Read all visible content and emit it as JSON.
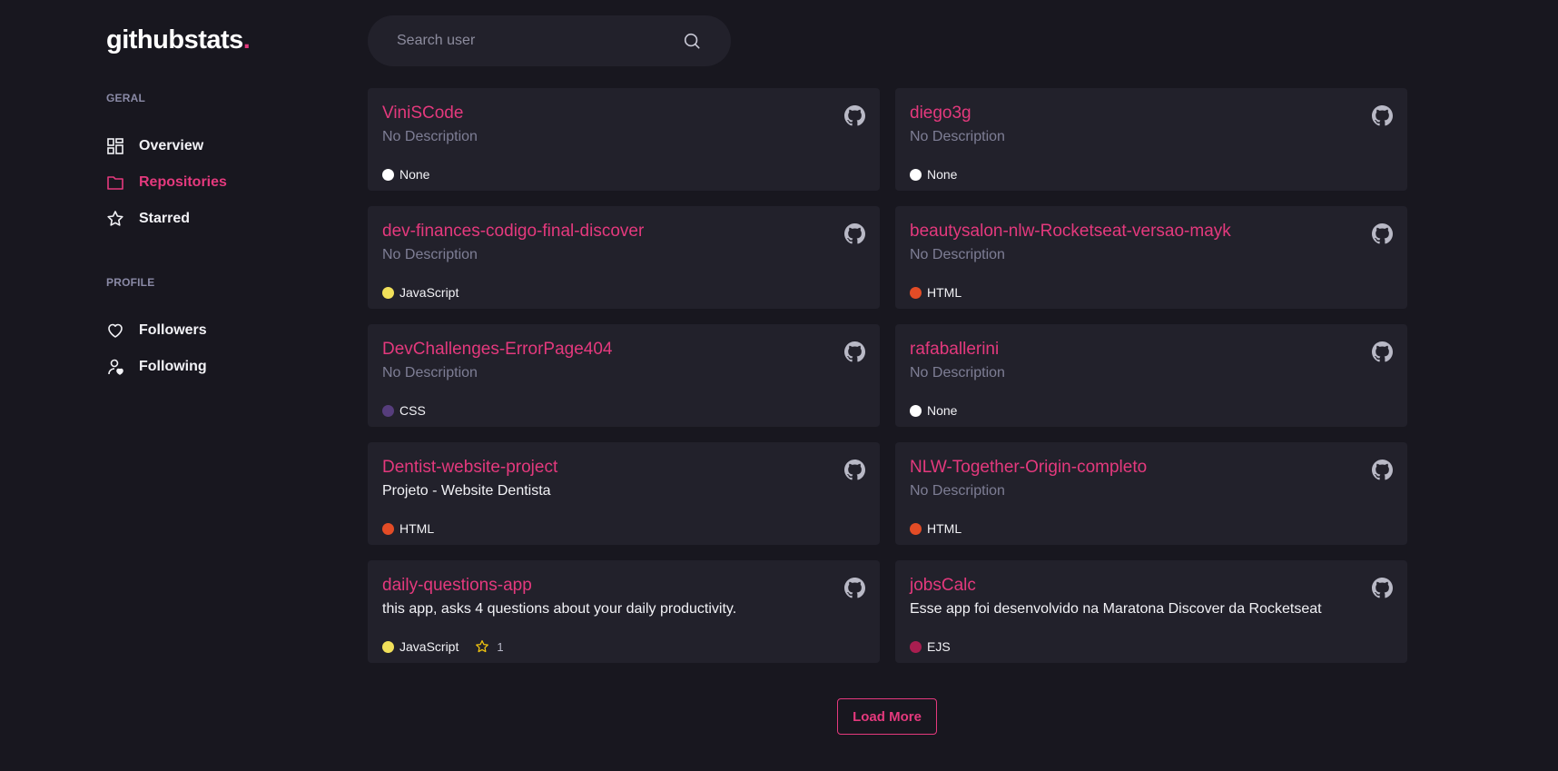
{
  "logo": {
    "text": "githubstats",
    "dot": "."
  },
  "sidebar": {
    "geral_title": "GERAL",
    "geral_items": [
      {
        "label": "Overview",
        "icon": "dashboard-icon"
      },
      {
        "label": "Repositories",
        "icon": "folder-icon"
      },
      {
        "label": "Starred",
        "icon": "star-icon"
      }
    ],
    "profile_title": "PROFILE",
    "profile_items": [
      {
        "label": "Followers",
        "icon": "heart-icon"
      },
      {
        "label": "Following",
        "icon": "user-heart-icon"
      }
    ]
  },
  "search": {
    "placeholder": "Search user",
    "value": ""
  },
  "repos": [
    {
      "name": "ViniSCode",
      "description": "No Description",
      "language": "None",
      "lang_color": "#ffffff",
      "stars": null
    },
    {
      "name": "diego3g",
      "description": "No Description",
      "language": "None",
      "lang_color": "#ffffff",
      "stars": null
    },
    {
      "name": "dev-finances-codigo-final-discover",
      "description": "No Description",
      "language": "JavaScript",
      "lang_color": "#f1e05a",
      "stars": null
    },
    {
      "name": "beautysalon-nlw-Rocketseat-versao-mayk",
      "description": "No Description",
      "language": "HTML",
      "lang_color": "#e34c26",
      "stars": null
    },
    {
      "name": "DevChallenges-ErrorPage404",
      "description": "No Description",
      "language": "CSS",
      "lang_color": "#563d7c",
      "stars": null
    },
    {
      "name": "rafaballerini",
      "description": "No Description",
      "language": "None",
      "lang_color": "#ffffff",
      "stars": null
    },
    {
      "name": "Dentist-website-project",
      "description": "Projeto - Website Dentista",
      "language": "HTML",
      "lang_color": "#e34c26",
      "stars": null
    },
    {
      "name": "NLW-Together-Origin-completo",
      "description": "No Description",
      "language": "HTML",
      "lang_color": "#e34c26",
      "stars": null
    },
    {
      "name": "daily-questions-app",
      "description": "this app, asks 4 questions about your daily productivity.",
      "language": "JavaScript",
      "lang_color": "#f1e05a",
      "stars": "1"
    },
    {
      "name": "jobsCalc",
      "description": "Esse app foi desenvolvido na Maratona Discover da Rocketseat",
      "language": "EJS",
      "lang_color": "#a91e50",
      "stars": null
    }
  ],
  "load_more_label": "Load More",
  "colors": {
    "accent": "#e4397d",
    "background": "#18171f",
    "card": "#22212b"
  }
}
